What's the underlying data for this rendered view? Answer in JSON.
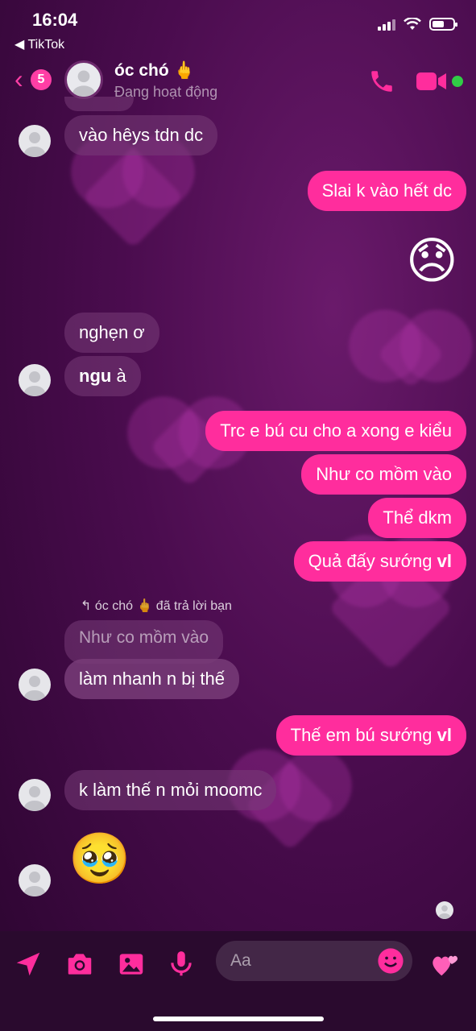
{
  "status_bar": {
    "time": "16:04",
    "back_app": "◀ TikTok"
  },
  "header": {
    "back_count": "5",
    "contact_name": "óc chó 🖕",
    "contact_status": "Đang hoạt động"
  },
  "messages": [
    {
      "side": "in",
      "text": "vào hêys tdn dc"
    },
    {
      "side": "out",
      "text": "Slai k vào hết dc"
    },
    {
      "side": "out",
      "emoji": "😞"
    },
    {
      "side": "in",
      "text": "nghẹn ơ"
    },
    {
      "side": "in",
      "bold": "ngu",
      "text": " à"
    },
    {
      "side": "out",
      "text": "Trc e bú cu cho a xong e kiểu"
    },
    {
      "side": "out",
      "text": "Như co mồm vào"
    },
    {
      "side": "out",
      "text": "Thể dkm"
    },
    {
      "side": "out",
      "text": "Quả đấy sướng ",
      "bold": "vl"
    },
    {
      "side": "in",
      "reply_note": "↰ óc chó 🖕 đã trả lời bạn",
      "quoted": "Như co mồm vào",
      "text": "làm nhanh n bị thế"
    },
    {
      "side": "out",
      "text": "Thế em bú sướng ",
      "bold": "vl"
    },
    {
      "side": "in",
      "text": "k làm thế n mỏi moomc"
    },
    {
      "side": "in",
      "emoji": "🥹"
    }
  ],
  "composer": {
    "placeholder": "Aa"
  },
  "colors": {
    "accent": "#ff2d9d",
    "online": "#31cc46"
  },
  "icons": [
    "send-location-icon",
    "camera-icon",
    "gallery-icon",
    "microphone-icon",
    "emoji-icon",
    "heart-icon"
  ]
}
